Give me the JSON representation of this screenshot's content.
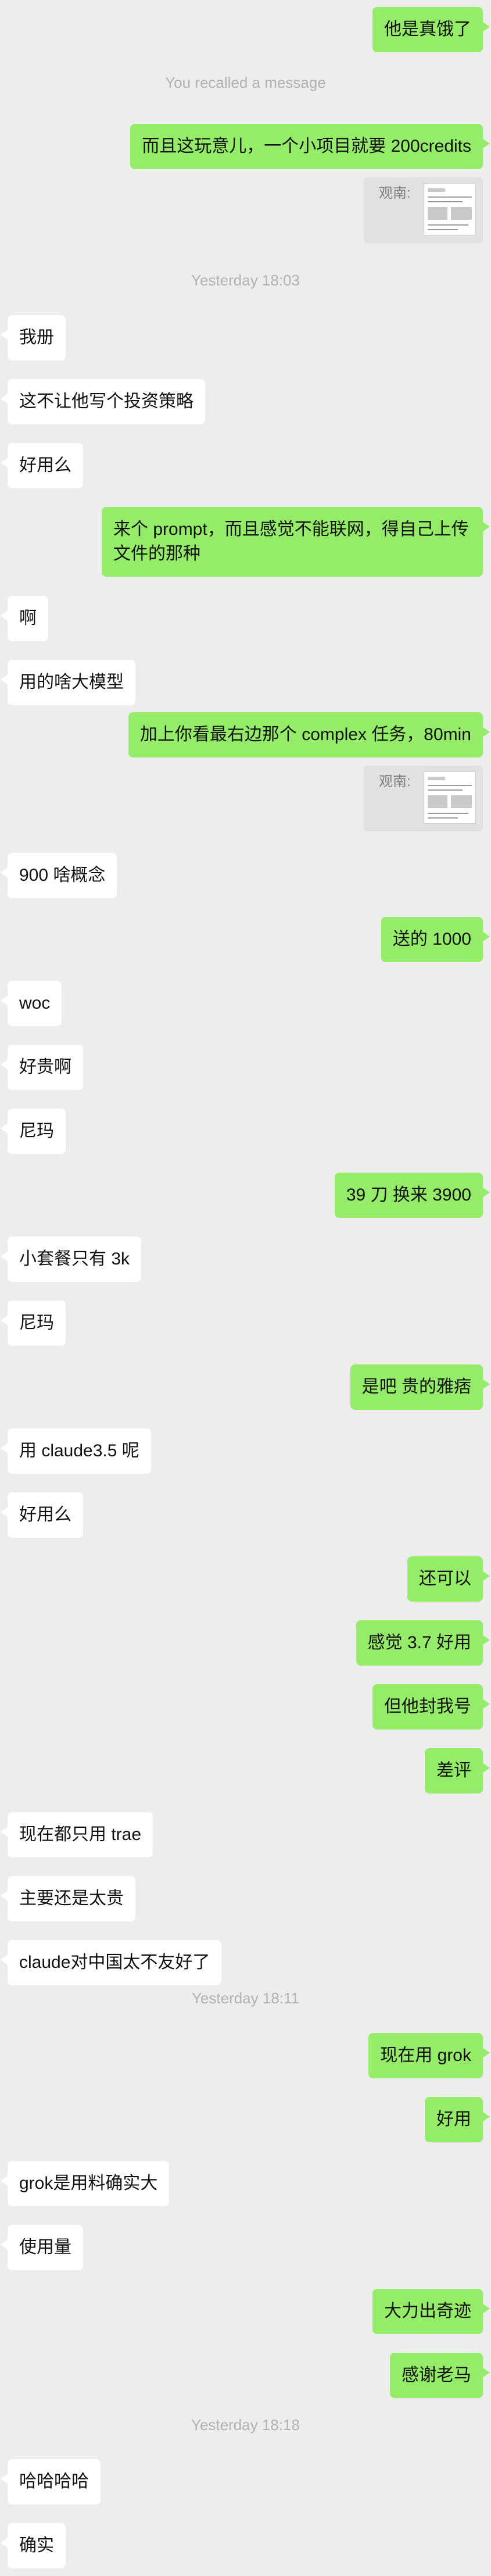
{
  "messages": [
    {
      "id": "m01",
      "type": "msg",
      "side": "right",
      "text": "他是真饿了"
    },
    {
      "id": "m02",
      "type": "system",
      "text": "You recalled a message"
    },
    {
      "id": "m03",
      "type": "msg",
      "side": "right",
      "text": "而且这玩意儿，一个小项目就要 200credits"
    },
    {
      "id": "m04",
      "type": "quote",
      "side": "right",
      "label": "观南:"
    },
    {
      "id": "m05",
      "type": "system",
      "text": "Yesterday 18:03"
    },
    {
      "id": "m06",
      "type": "msg",
      "side": "left",
      "text": "我册"
    },
    {
      "id": "m07",
      "type": "msg",
      "side": "left",
      "text": "这不让他写个投资策略"
    },
    {
      "id": "m08",
      "type": "msg",
      "side": "left",
      "text": "好用么"
    },
    {
      "id": "m09",
      "type": "msg",
      "side": "right",
      "text": "来个 prompt，而且感觉不能联网，得自己上传文件的那种"
    },
    {
      "id": "m10",
      "type": "msg",
      "side": "left",
      "text": "啊"
    },
    {
      "id": "m11",
      "type": "msg",
      "side": "left",
      "text": "用的啥大模型"
    },
    {
      "id": "m12",
      "type": "msg",
      "side": "right",
      "text": "加上你看最右边那个 complex 任务，80min"
    },
    {
      "id": "m13",
      "type": "quote",
      "side": "right",
      "label": "观南:"
    },
    {
      "id": "m14",
      "type": "msg",
      "side": "left",
      "text": "900 啥概念"
    },
    {
      "id": "m15",
      "type": "msg",
      "side": "right",
      "text": "送的 1000"
    },
    {
      "id": "m16",
      "type": "msg",
      "side": "left",
      "text": "woc"
    },
    {
      "id": "m17",
      "type": "msg",
      "side": "left",
      "text": "好贵啊"
    },
    {
      "id": "m18",
      "type": "msg",
      "side": "left",
      "text": "尼玛"
    },
    {
      "id": "m19",
      "type": "msg",
      "side": "right",
      "text": "39 刀 换来 3900"
    },
    {
      "id": "m20",
      "type": "msg",
      "side": "left",
      "text": "小套餐只有 3k"
    },
    {
      "id": "m21",
      "type": "msg",
      "side": "left",
      "text": "尼玛"
    },
    {
      "id": "m22",
      "type": "msg",
      "side": "right",
      "text": "是吧 贵的雅痞"
    },
    {
      "id": "m23",
      "type": "msg",
      "side": "left",
      "text": "用 claude3.5 呢"
    },
    {
      "id": "m24",
      "type": "msg",
      "side": "left",
      "text": "好用么"
    },
    {
      "id": "m25",
      "type": "msg",
      "side": "right",
      "text": "还可以"
    },
    {
      "id": "m26",
      "type": "msg",
      "side": "right",
      "text": "感觉 3.7 好用"
    },
    {
      "id": "m27",
      "type": "msg",
      "side": "right",
      "text": "但他封我号"
    },
    {
      "id": "m28",
      "type": "msg",
      "side": "right",
      "text": "差评"
    },
    {
      "id": "m29",
      "type": "msg",
      "side": "left",
      "text": "现在都只用 trae"
    },
    {
      "id": "m30",
      "type": "msg",
      "side": "left",
      "text": "主要还是太贵"
    },
    {
      "id": "m31",
      "type": "msg",
      "side": "left",
      "text": "claude对中国太不友好了"
    },
    {
      "id": "m32",
      "type": "system",
      "text": "Yesterday 18:11"
    },
    {
      "id": "m33",
      "type": "msg",
      "side": "right",
      "text": "现在用 grok"
    },
    {
      "id": "m34",
      "type": "msg",
      "side": "right",
      "text": "好用"
    },
    {
      "id": "m35",
      "type": "msg",
      "side": "left",
      "text": "grok是用料确实大"
    },
    {
      "id": "m36",
      "type": "msg",
      "side": "left",
      "text": "使用量"
    },
    {
      "id": "m37",
      "type": "msg",
      "side": "right",
      "text": "大力出奇迹"
    },
    {
      "id": "m38",
      "type": "msg",
      "side": "right",
      "text": "感谢老马"
    },
    {
      "id": "m39",
      "type": "system",
      "text": "Yesterday 18:18"
    },
    {
      "id": "m40",
      "type": "msg",
      "side": "left",
      "text": "哈哈哈哈"
    },
    {
      "id": "m41",
      "type": "msg",
      "side": "left",
      "text": "确实"
    }
  ],
  "colors": {
    "background": "#ededed",
    "bubble_self": "#95ec69",
    "bubble_other": "#ffffff",
    "system_text": "#b2b2b2",
    "quote_bg": "#e1e1e1"
  }
}
